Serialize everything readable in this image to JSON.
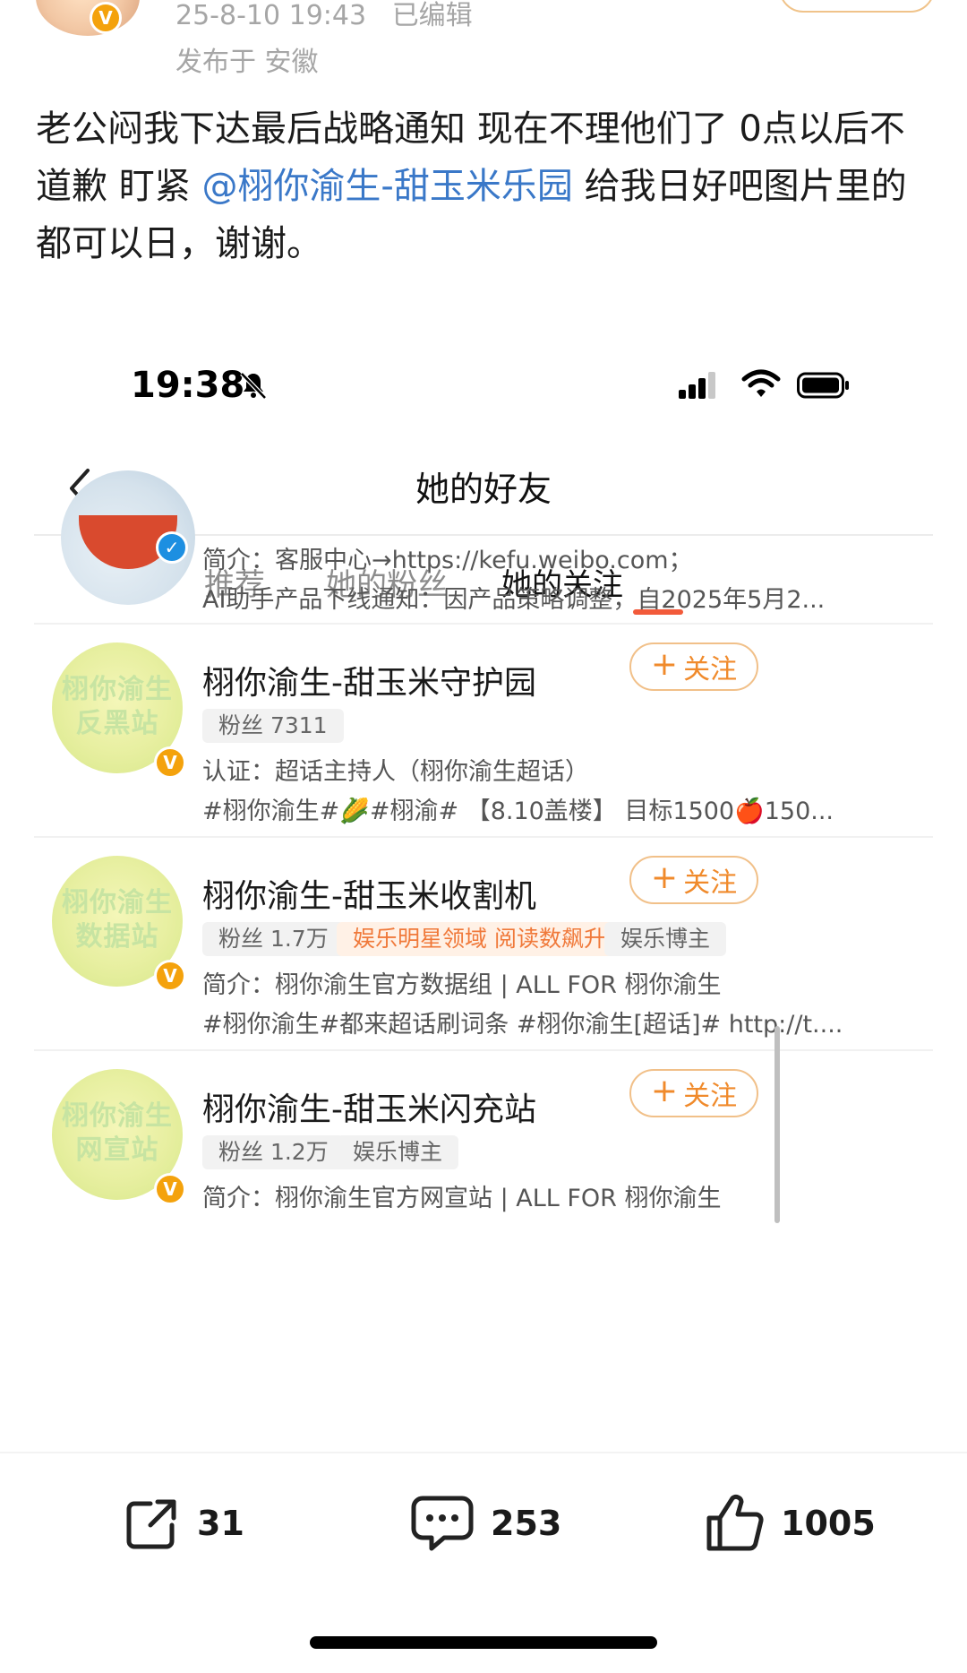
{
  "post": {
    "time": "25-8-10 19:43",
    "edited": "已编辑",
    "location": "发布于 安徽",
    "text_before": "老公闷我下达最后战略通知 现在不理他们了 0点以后不道歉 盯紧 ",
    "mention": "@栩你渝生-甜玉米乐园",
    "text_after": " 给我日好吧图片里的都可以日，谢谢。",
    "accent_color": "#3a78c8"
  },
  "screenshot": {
    "status_time": "19:38",
    "nav_title": "她的好友",
    "tabs": [
      {
        "label": "推荐"
      },
      {
        "label": "她的粉丝"
      },
      {
        "label": "她的关注"
      }
    ],
    "partial_row": {
      "desc1": "简介：客服中心→https://kefu.weibo.com；",
      "desc2": "AI助手产品下线通知：因产品策略调整，自2025年5月2..."
    },
    "rows": [
      {
        "avatar_text": "栩你渝生\n反黑站",
        "name": "栩你渝生-甜玉米守护园",
        "chips": [
          "粉丝 7311"
        ],
        "desc1": "认证：超话主持人（栩你渝生超话）",
        "desc2": "#栩你渝生#🌽#栩渝# 【8.10盖楼】 目标1500🍎150...",
        "follow": "关注"
      },
      {
        "avatar_text": "栩你渝生\n数据站",
        "name": "栩你渝生-甜玉米收割机",
        "chips": [
          "粉丝 1.7万",
          "娱乐明星领域 阅读数飙升",
          "娱乐博主"
        ],
        "desc1": "简介：栩你渝生官方数据组 | ALL FOR 栩你渝生",
        "desc2": "#栩你渝生#都来超话刷词条 #栩你渝生[超话]# http://t....",
        "follow": "关注"
      },
      {
        "avatar_text": "栩你渝生\n网宣站",
        "name": "栩你渝生-甜玉米闪充站",
        "chips": [
          "粉丝 1.2万",
          "娱乐博主"
        ],
        "desc1": "简介：栩你渝生官方网宣站 | ALL FOR 栩你渝生",
        "follow": "关注"
      }
    ]
  },
  "actions": {
    "repost_count": "31",
    "comment_count": "253",
    "like_count": "1005"
  }
}
